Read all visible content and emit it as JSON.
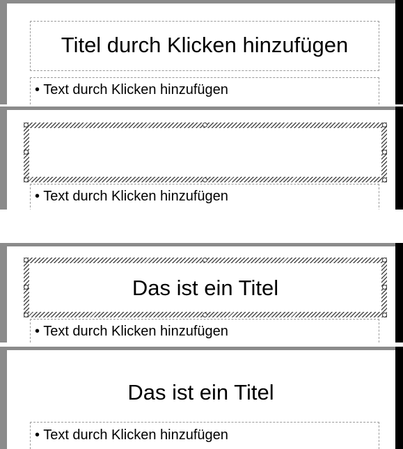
{
  "panel1": {
    "title": "Titel durch Klicken hinzufügen",
    "body": "• Text durch Klicken hinzufügen"
  },
  "panel2": {
    "title": "",
    "body": "• Text durch Klicken hinzufügen"
  },
  "panel3": {
    "title": "Das ist ein Titel",
    "body": "• Text durch Klicken hinzufügen"
  },
  "panel4": {
    "title": "Das ist ein Titel",
    "body": "• Text durch Klicken hinzufügen"
  }
}
